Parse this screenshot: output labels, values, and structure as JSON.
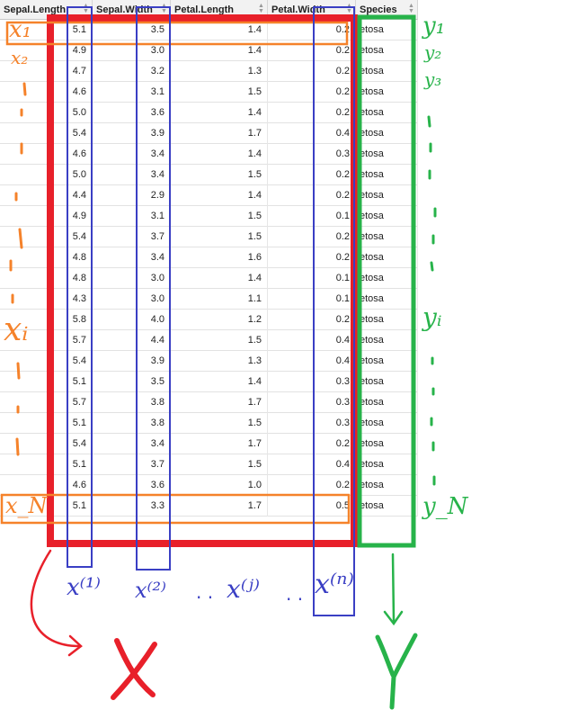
{
  "table": {
    "columns": [
      {
        "label": "Sepal.Length",
        "sortable": true
      },
      {
        "label": "Sepal.Width",
        "sortable": true
      },
      {
        "label": "Petal.Length",
        "sortable": true
      },
      {
        "label": "Petal.Width",
        "sortable": true
      },
      {
        "label": "Species",
        "sortable": true
      }
    ],
    "rows": [
      [
        "5.1",
        "3.5",
        "1.4",
        "0.2",
        "etosa"
      ],
      [
        "4.9",
        "3.0",
        "1.4",
        "0.2",
        "etosa"
      ],
      [
        "4.7",
        "3.2",
        "1.3",
        "0.2",
        "etosa"
      ],
      [
        "4.6",
        "3.1",
        "1.5",
        "0.2",
        "etosa"
      ],
      [
        "5.0",
        "3.6",
        "1.4",
        "0.2",
        "etosa"
      ],
      [
        "5.4",
        "3.9",
        "1.7",
        "0.4",
        "etosa"
      ],
      [
        "4.6",
        "3.4",
        "1.4",
        "0.3",
        "etosa"
      ],
      [
        "5.0",
        "3.4",
        "1.5",
        "0.2",
        "etosa"
      ],
      [
        "4.4",
        "2.9",
        "1.4",
        "0.2",
        "etosa"
      ],
      [
        "4.9",
        "3.1",
        "1.5",
        "0.1",
        "etosa"
      ],
      [
        "5.4",
        "3.7",
        "1.5",
        "0.2",
        "etosa"
      ],
      [
        "4.8",
        "3.4",
        "1.6",
        "0.2",
        "etosa"
      ],
      [
        "4.8",
        "3.0",
        "1.4",
        "0.1",
        "etosa"
      ],
      [
        "4.3",
        "3.0",
        "1.1",
        "0.1",
        "etosa"
      ],
      [
        "5.8",
        "4.0",
        "1.2",
        "0.2",
        "etosa"
      ],
      [
        "5.7",
        "4.4",
        "1.5",
        "0.4",
        "etosa"
      ],
      [
        "5.4",
        "3.9",
        "1.3",
        "0.4",
        "etosa"
      ],
      [
        "5.1",
        "3.5",
        "1.4",
        "0.3",
        "etosa"
      ],
      [
        "5.7",
        "3.8",
        "1.7",
        "0.3",
        "etosa"
      ],
      [
        "5.1",
        "3.8",
        "1.5",
        "0.3",
        "etosa"
      ],
      [
        "5.4",
        "3.4",
        "1.7",
        "0.2",
        "etosa"
      ],
      [
        "5.1",
        "3.7",
        "1.5",
        "0.4",
        "etosa"
      ],
      [
        "4.6",
        "3.6",
        "1.0",
        "0.2",
        "etosa"
      ],
      [
        "5.1",
        "3.3",
        "1.7",
        "0.5",
        "etosa"
      ]
    ]
  },
  "annotations": {
    "colors": {
      "orange": "#f5822a",
      "red": "#e8202a",
      "blue": "#3a3fc4",
      "green": "#27b34a"
    },
    "rows_left": {
      "first": "x₁",
      "second": "x₂",
      "middle": "xᵢ",
      "last": "x_N"
    },
    "targets_right": {
      "first": "y₁",
      "second": "y₂",
      "third": "y₃",
      "middle": "yᵢ",
      "last": "y_N"
    },
    "feature_labels": {
      "first": "x⁽¹⁾",
      "second": "x⁽²⁾",
      "dots1": "· ·",
      "middle": "x⁽ʲ⁾",
      "dots2": "· ·",
      "last": "x⁽ⁿ⁾"
    },
    "matrix_label": "X",
    "vector_label": "Y"
  }
}
